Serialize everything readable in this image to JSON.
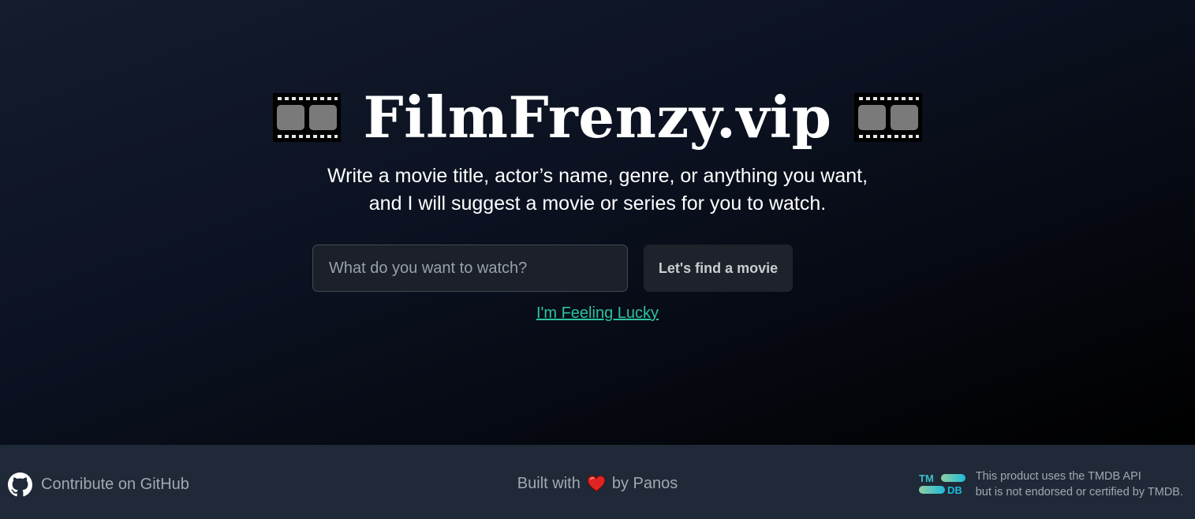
{
  "hero": {
    "title": "FilmFrenzy.vip",
    "subtitle_line1": "Write a movie title, actor’s name, genre, or anything you want,",
    "subtitle_line2": "and I will suggest a movie or series for you to watch.",
    "icons": {
      "left": "film-frames-icon",
      "right": "film-frames-icon"
    }
  },
  "search": {
    "placeholder": "What do you want to watch?",
    "value": "",
    "button_label": "Let's find a movie",
    "lucky_label": "I'm Feeling Lucky"
  },
  "footer": {
    "github_icon": "github-icon",
    "github_label": "Contribute on GitHub",
    "built_prefix": "Built with",
    "heart_icon": "heart-icon",
    "built_suffix": "by Panos",
    "tmdb_logo_text_top": "TM",
    "tmdb_logo_text_bottom": "DB",
    "tmdb_line1": "This product uses the TMDB API",
    "tmdb_line2": "but is not endorsed or certified by TMDB."
  },
  "colors": {
    "accent_link": "#2dc2a0",
    "footer_bg": "#1f2937",
    "heart": "#e02424",
    "tmdb_teal": "#1dbad9",
    "tmdb_green": "#90cea1"
  }
}
